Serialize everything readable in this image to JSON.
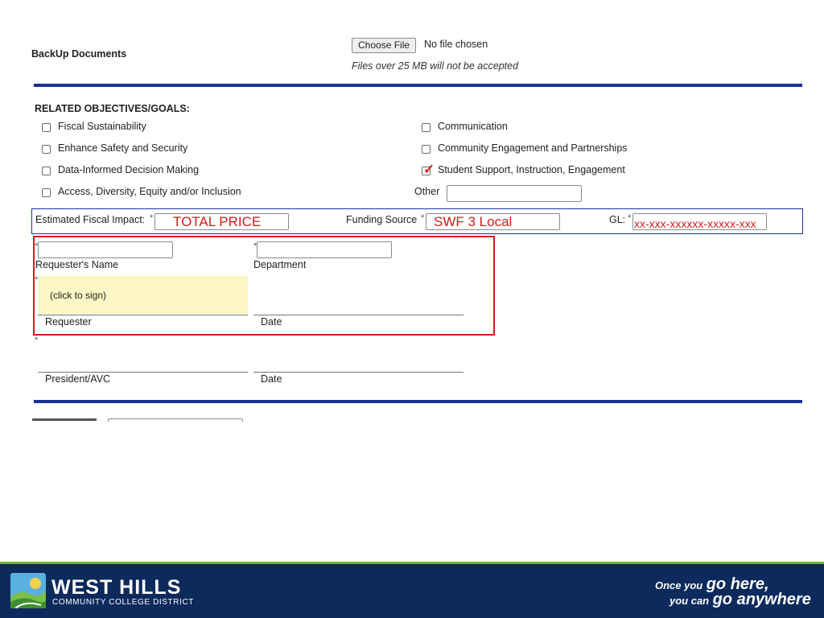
{
  "backup": {
    "label": "BackUp Documents",
    "choose_file": "Choose File",
    "no_file": "No file chosen",
    "note": "Files over 25 MB will not be accepted"
  },
  "objectives": {
    "heading": "RELATED OBJECTIVES/GOALS:",
    "left": [
      {
        "label": "Fiscal Sustainability",
        "checked": false
      },
      {
        "label": "Enhance Safety and Security",
        "checked": false
      },
      {
        "label": "Data-Informed Decision Making",
        "checked": false
      },
      {
        "label": "Access, Diversity, Equity and/or Inclusion",
        "checked": false
      }
    ],
    "right": [
      {
        "label": "Communication",
        "checked": false
      },
      {
        "label": "Community Engagement and Partnerships",
        "checked": false
      },
      {
        "label": "Student Support, Instruction, Engagement",
        "checked": true
      }
    ],
    "other_label": "Other",
    "other_value": ""
  },
  "fiscal": {
    "impact_label": "Estimated Fiscal Impact:",
    "impact_value": "TOTAL PRICE",
    "funding_label": "Funding Source",
    "funding_value": "SWF 3 Local",
    "gl_label": "GL:",
    "gl_value": "xx-xxx-xxxxxx-xxxxx-xxx",
    "required_mark": "*"
  },
  "requester": {
    "name_label": "Requester's Name",
    "department_label": "Department",
    "sign_prompt": "(click to sign)",
    "requester_label": "Requester",
    "date_label": "Date"
  },
  "approval": {
    "president_label": "President/AVC",
    "date_label": "Date"
  },
  "footer": {
    "brand_line1": "WEST HILLS",
    "brand_line2": "COMMUNITY COLLEGE DISTRICT",
    "tag1_small": "Once you",
    "tag1_large": "go here,",
    "tag2_small": "you can",
    "tag2_large": "go anywhere",
    "colors": {
      "navy": "#0c2a5c",
      "green": "#71b443"
    }
  },
  "colors": {
    "rule": "#1f2f99",
    "highlight": "#d41b1b",
    "sign_bg": "#fdf7c5"
  }
}
